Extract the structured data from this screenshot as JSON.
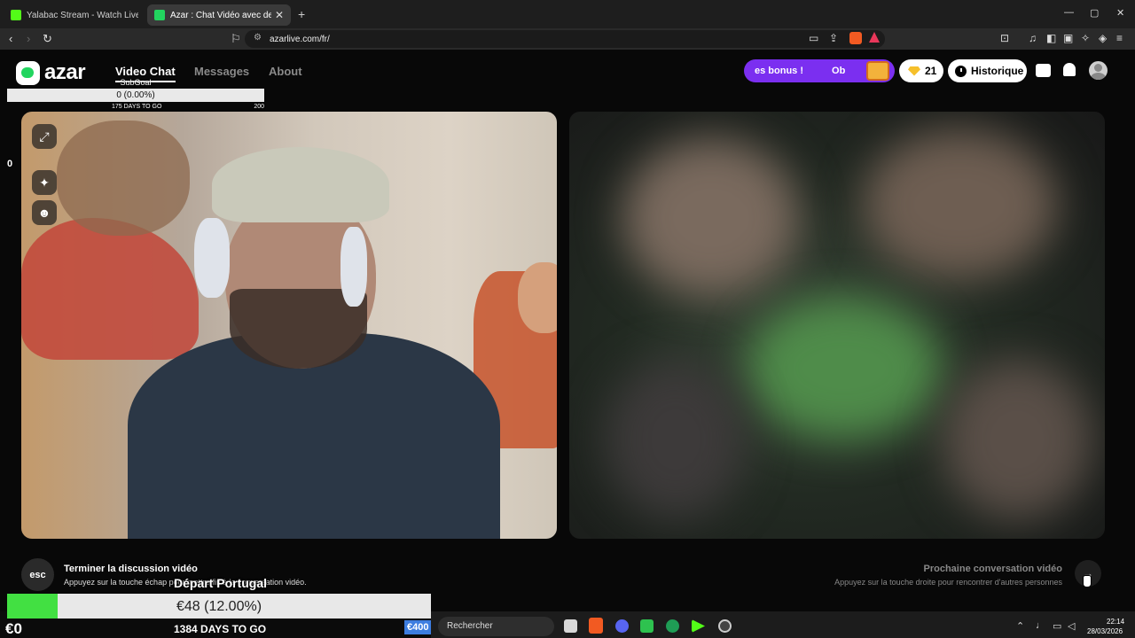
{
  "browser": {
    "tabs": [
      {
        "title": "Yalabac Stream - Watch Live on Kick",
        "active": false,
        "favicon_color": "#53fc18"
      },
      {
        "title": "Azar : Chat Vidéo avec de no",
        "active": true,
        "favicon_color": "#22d55f",
        "close": "✕"
      }
    ],
    "new_tab": "+",
    "window_controls": {
      "minimize": "—",
      "maximize": "▢",
      "close": "✕"
    },
    "url": "azarlive.com/fr/"
  },
  "header": {
    "logo": "azar",
    "nav": [
      {
        "label": "Video Chat",
        "active": true
      },
      {
        "label": "Messages",
        "active": false
      },
      {
        "label": "About",
        "active": false
      }
    ],
    "bonus": {
      "text1": "es bonus !",
      "text2": "Ob"
    },
    "gems_count": "21",
    "history_label": "Historique"
  },
  "self_video": {
    "side_buttons": [
      "⤢",
      "✦",
      "☻"
    ]
  },
  "subgoal": {
    "label": "SubGoal",
    "value": "0 (0.00%)",
    "days": "175 DAYS TO GO",
    "min": "0",
    "max": "200"
  },
  "controls": {
    "esc_key": "esc",
    "end_title": "Terminer la discussion vidéo",
    "end_sub": "Appuyez sur la touche échap p",
    "end_sub_tail": "our mettre fin à la conversation vidéo.",
    "next_title": "Prochaine conversation vidéo",
    "next_sub": "Appuyez sur la touche droite pour rencontrer d'autres personnes",
    "next_icon": "→"
  },
  "donation_goal": {
    "title": "Départ Portugal",
    "value": "€48 (12.00%)",
    "progress": 0.12,
    "min": "€0",
    "days": "1384 DAYS TO GO",
    "fill_color": "#42e042"
  },
  "taskbar": {
    "badge": "€400",
    "search_placeholder": "Rechercher",
    "time": "22:14",
    "date": "28/03/2026"
  }
}
